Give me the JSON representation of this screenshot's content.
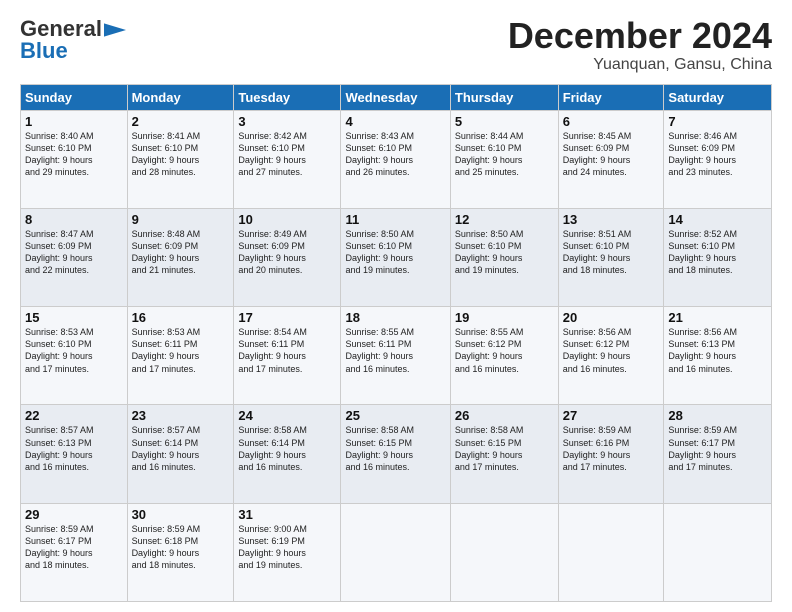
{
  "logo": {
    "line1": "General",
    "line2": "Blue",
    "arrow_color": "#1a6eb5"
  },
  "title": "December 2024",
  "location": "Yuanquan, Gansu, China",
  "days_of_week": [
    "Sunday",
    "Monday",
    "Tuesday",
    "Wednesday",
    "Thursday",
    "Friday",
    "Saturday"
  ],
  "weeks": [
    [
      {
        "day": "1",
        "info": "Sunrise: 8:40 AM\nSunset: 6:10 PM\nDaylight: 9 hours\nand 29 minutes."
      },
      {
        "day": "2",
        "info": "Sunrise: 8:41 AM\nSunset: 6:10 PM\nDaylight: 9 hours\nand 28 minutes."
      },
      {
        "day": "3",
        "info": "Sunrise: 8:42 AM\nSunset: 6:10 PM\nDaylight: 9 hours\nand 27 minutes."
      },
      {
        "day": "4",
        "info": "Sunrise: 8:43 AM\nSunset: 6:10 PM\nDaylight: 9 hours\nand 26 minutes."
      },
      {
        "day": "5",
        "info": "Sunrise: 8:44 AM\nSunset: 6:10 PM\nDaylight: 9 hours\nand 25 minutes."
      },
      {
        "day": "6",
        "info": "Sunrise: 8:45 AM\nSunset: 6:09 PM\nDaylight: 9 hours\nand 24 minutes."
      },
      {
        "day": "7",
        "info": "Sunrise: 8:46 AM\nSunset: 6:09 PM\nDaylight: 9 hours\nand 23 minutes."
      }
    ],
    [
      {
        "day": "8",
        "info": "Sunrise: 8:47 AM\nSunset: 6:09 PM\nDaylight: 9 hours\nand 22 minutes."
      },
      {
        "day": "9",
        "info": "Sunrise: 8:48 AM\nSunset: 6:09 PM\nDaylight: 9 hours\nand 21 minutes."
      },
      {
        "day": "10",
        "info": "Sunrise: 8:49 AM\nSunset: 6:09 PM\nDaylight: 9 hours\nand 20 minutes."
      },
      {
        "day": "11",
        "info": "Sunrise: 8:50 AM\nSunset: 6:10 PM\nDaylight: 9 hours\nand 19 minutes."
      },
      {
        "day": "12",
        "info": "Sunrise: 8:50 AM\nSunset: 6:10 PM\nDaylight: 9 hours\nand 19 minutes."
      },
      {
        "day": "13",
        "info": "Sunrise: 8:51 AM\nSunset: 6:10 PM\nDaylight: 9 hours\nand 18 minutes."
      },
      {
        "day": "14",
        "info": "Sunrise: 8:52 AM\nSunset: 6:10 PM\nDaylight: 9 hours\nand 18 minutes."
      }
    ],
    [
      {
        "day": "15",
        "info": "Sunrise: 8:53 AM\nSunset: 6:10 PM\nDaylight: 9 hours\nand 17 minutes."
      },
      {
        "day": "16",
        "info": "Sunrise: 8:53 AM\nSunset: 6:11 PM\nDaylight: 9 hours\nand 17 minutes."
      },
      {
        "day": "17",
        "info": "Sunrise: 8:54 AM\nSunset: 6:11 PM\nDaylight: 9 hours\nand 17 minutes."
      },
      {
        "day": "18",
        "info": "Sunrise: 8:55 AM\nSunset: 6:11 PM\nDaylight: 9 hours\nand 16 minutes."
      },
      {
        "day": "19",
        "info": "Sunrise: 8:55 AM\nSunset: 6:12 PM\nDaylight: 9 hours\nand 16 minutes."
      },
      {
        "day": "20",
        "info": "Sunrise: 8:56 AM\nSunset: 6:12 PM\nDaylight: 9 hours\nand 16 minutes."
      },
      {
        "day": "21",
        "info": "Sunrise: 8:56 AM\nSunset: 6:13 PM\nDaylight: 9 hours\nand 16 minutes."
      }
    ],
    [
      {
        "day": "22",
        "info": "Sunrise: 8:57 AM\nSunset: 6:13 PM\nDaylight: 9 hours\nand 16 minutes."
      },
      {
        "day": "23",
        "info": "Sunrise: 8:57 AM\nSunset: 6:14 PM\nDaylight: 9 hours\nand 16 minutes."
      },
      {
        "day": "24",
        "info": "Sunrise: 8:58 AM\nSunset: 6:14 PM\nDaylight: 9 hours\nand 16 minutes."
      },
      {
        "day": "25",
        "info": "Sunrise: 8:58 AM\nSunset: 6:15 PM\nDaylight: 9 hours\nand 16 minutes."
      },
      {
        "day": "26",
        "info": "Sunrise: 8:58 AM\nSunset: 6:15 PM\nDaylight: 9 hours\nand 17 minutes."
      },
      {
        "day": "27",
        "info": "Sunrise: 8:59 AM\nSunset: 6:16 PM\nDaylight: 9 hours\nand 17 minutes."
      },
      {
        "day": "28",
        "info": "Sunrise: 8:59 AM\nSunset: 6:17 PM\nDaylight: 9 hours\nand 17 minutes."
      }
    ],
    [
      {
        "day": "29",
        "info": "Sunrise: 8:59 AM\nSunset: 6:17 PM\nDaylight: 9 hours\nand 18 minutes."
      },
      {
        "day": "30",
        "info": "Sunrise: 8:59 AM\nSunset: 6:18 PM\nDaylight: 9 hours\nand 18 minutes."
      },
      {
        "day": "31",
        "info": "Sunrise: 9:00 AM\nSunset: 6:19 PM\nDaylight: 9 hours\nand 19 minutes."
      },
      null,
      null,
      null,
      null
    ]
  ]
}
